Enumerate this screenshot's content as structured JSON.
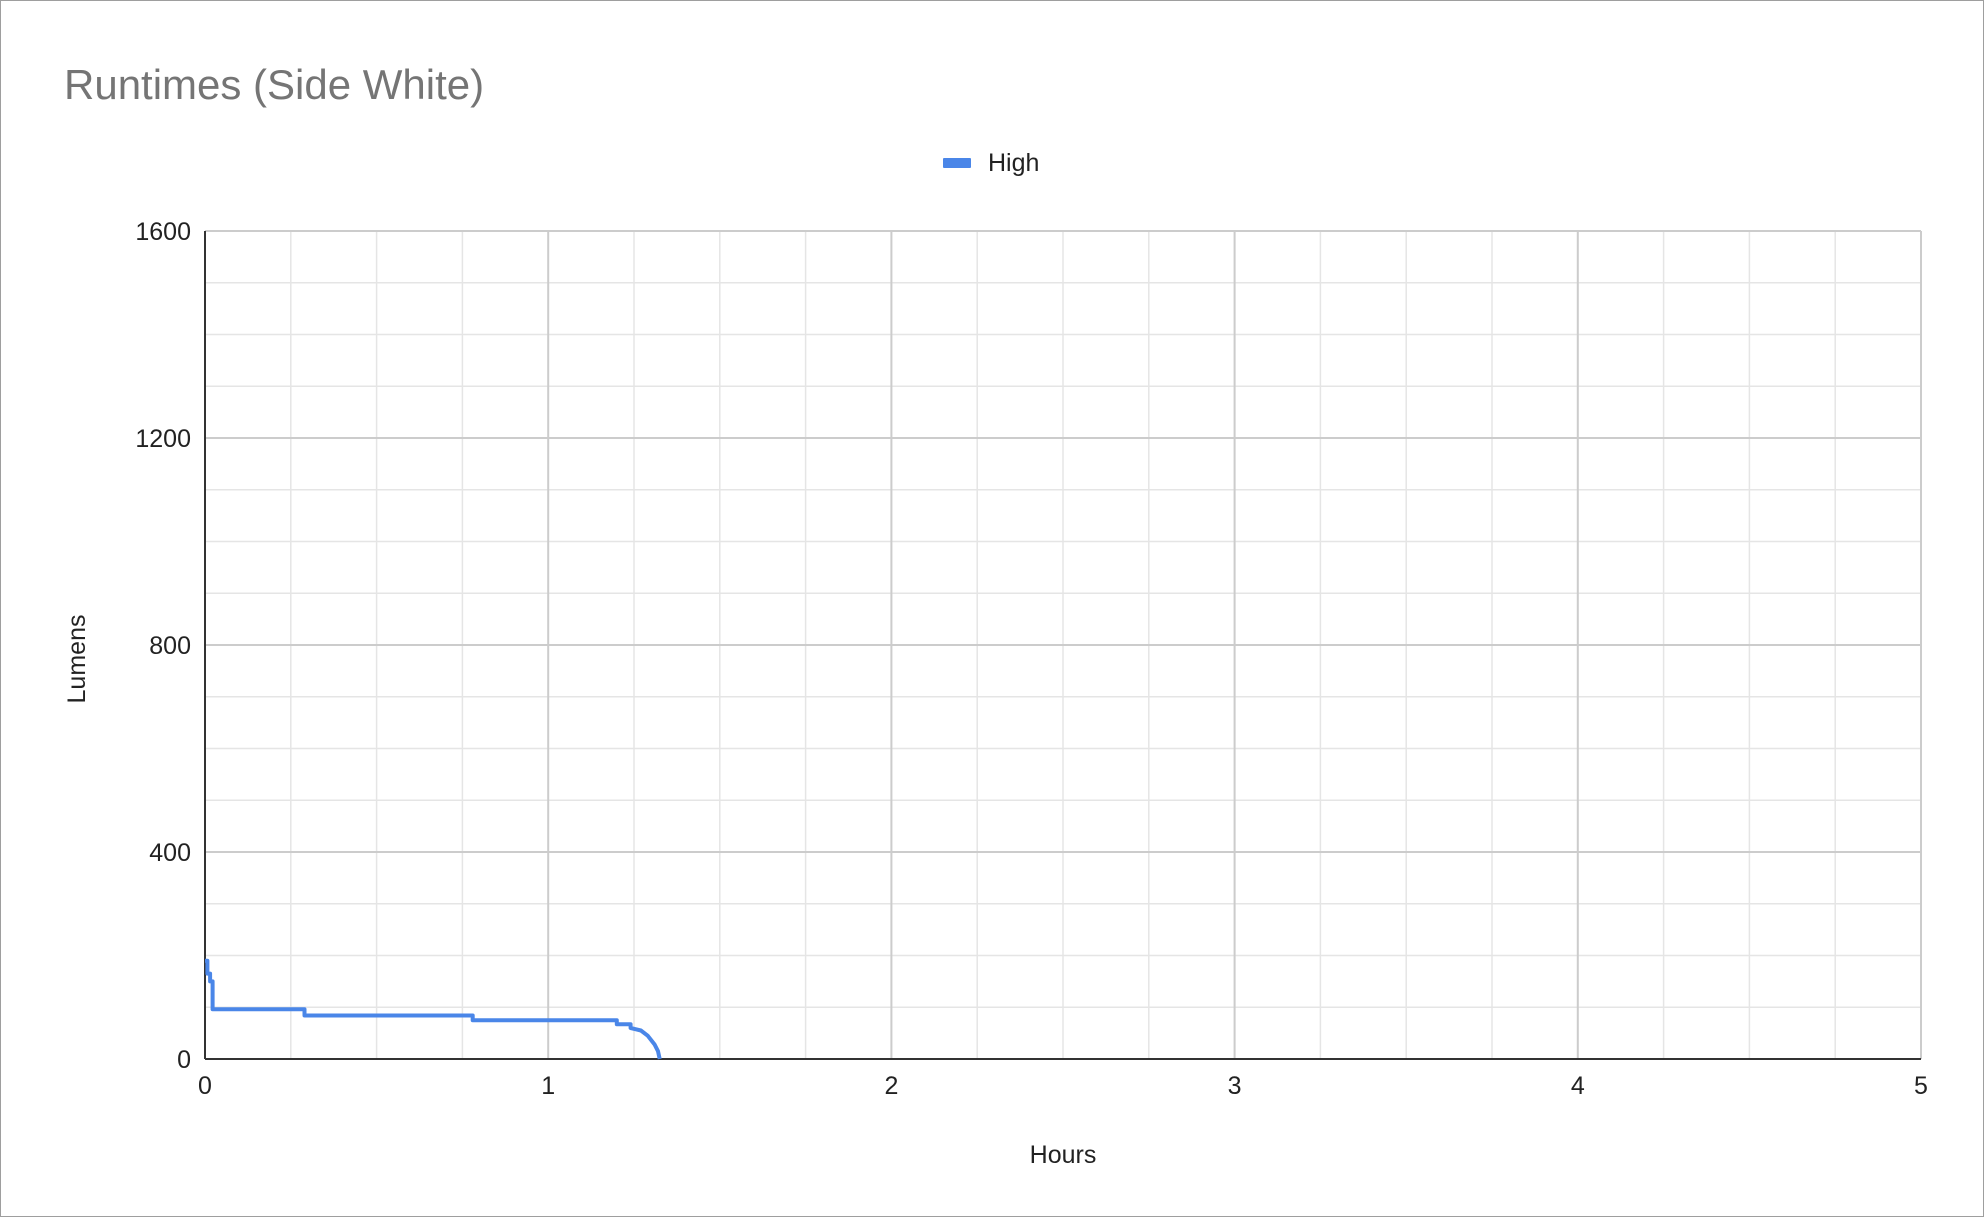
{
  "chart_data": {
    "type": "line",
    "title": "Runtimes (Side White)",
    "xlabel": "Hours",
    "ylabel": "Lumens",
    "xlim": [
      0,
      5
    ],
    "ylim": [
      0,
      1600
    ],
    "x_ticks": [
      0,
      1,
      2,
      3,
      4,
      5
    ],
    "y_ticks": [
      0,
      400,
      800,
      1200,
      1600
    ],
    "x_minor_step": 0.25,
    "y_minor_step": 100,
    "grid": true,
    "legend_position": "top-center",
    "series": [
      {
        "name": "High",
        "color": "#4a86e8",
        "points": [
          [
            0.0,
            190
          ],
          [
            0.007,
            190
          ],
          [
            0.007,
            165
          ],
          [
            0.015,
            165
          ],
          [
            0.015,
            150
          ],
          [
            0.022,
            150
          ],
          [
            0.022,
            96
          ],
          [
            0.29,
            96
          ],
          [
            0.29,
            84
          ],
          [
            0.78,
            84
          ],
          [
            0.78,
            75
          ],
          [
            1.2,
            75
          ],
          [
            1.2,
            67
          ],
          [
            1.24,
            67
          ],
          [
            1.24,
            60
          ],
          [
            1.27,
            55
          ],
          [
            1.29,
            45
          ],
          [
            1.31,
            28
          ],
          [
            1.32,
            15
          ],
          [
            1.325,
            0
          ]
        ]
      }
    ]
  }
}
